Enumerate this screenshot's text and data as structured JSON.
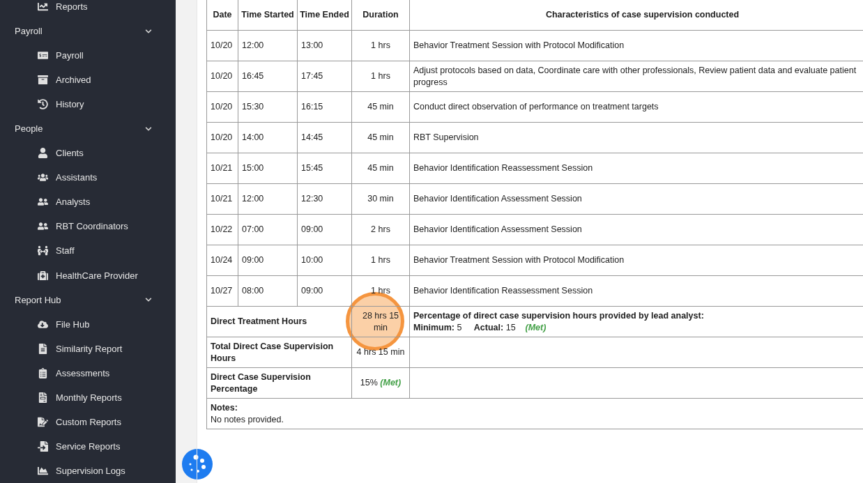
{
  "sidebar": {
    "items": [
      {
        "kind": "link",
        "label": "Reports"
      },
      {
        "kind": "section",
        "label": "Payroll",
        "expanded": true
      },
      {
        "kind": "link",
        "label": "Payroll"
      },
      {
        "kind": "link",
        "label": "Archived"
      },
      {
        "kind": "link",
        "label": "History"
      },
      {
        "kind": "section",
        "label": "People",
        "expanded": true
      },
      {
        "kind": "link",
        "label": "Clients"
      },
      {
        "kind": "link",
        "label": "Assistants"
      },
      {
        "kind": "link",
        "label": "Analysts"
      },
      {
        "kind": "link",
        "label": "RBT Coordinators"
      },
      {
        "kind": "link",
        "label": "Staff"
      },
      {
        "kind": "link",
        "label": "HealthCare Provider"
      },
      {
        "kind": "section",
        "label": "Report Hub",
        "expanded": true
      },
      {
        "kind": "link",
        "label": "File Hub"
      },
      {
        "kind": "link",
        "label": "Similarity Report"
      },
      {
        "kind": "link",
        "label": "Assessments"
      },
      {
        "kind": "link",
        "label": "Monthly Reports"
      },
      {
        "kind": "link",
        "label": "Custom Reports"
      },
      {
        "kind": "link",
        "label": "Service Reports"
      },
      {
        "kind": "link",
        "label": "Supervision Logs"
      }
    ]
  },
  "table": {
    "columns": [
      "Date",
      "Time Started",
      "Time Ended",
      "Duration",
      "Characteristics of case supervision conducted"
    ],
    "rows": [
      {
        "date": "10/20",
        "start": "12:00",
        "end": "13:00",
        "duration": "1 hrs",
        "characteristics": "Behavior Treatment Session with Protocol Modification"
      },
      {
        "date": "10/20",
        "start": "16:45",
        "end": "17:45",
        "duration": "1 hrs",
        "characteristics": "Adjust protocols based on data, Coordinate care with other professionals, Review patient data and evaluate patient progress"
      },
      {
        "date": "10/20",
        "start": "15:30",
        "end": "16:15",
        "duration": "45 min",
        "characteristics": "Conduct direct observation of performance on treatment targets"
      },
      {
        "date": "10/20",
        "start": "14:00",
        "end": "14:45",
        "duration": "45 min",
        "characteristics": "RBT Supervision"
      },
      {
        "date": "10/21",
        "start": "15:00",
        "end": "15:45",
        "duration": "45 min",
        "characteristics": "Behavior Identification Reassessment Session"
      },
      {
        "date": "10/21",
        "start": "12:00",
        "end": "12:30",
        "duration": "30 min",
        "characteristics": "Behavior Identification Assessment Session"
      },
      {
        "date": "10/22",
        "start": "07:00",
        "end": "09:00",
        "duration": "2 hrs",
        "characteristics": "Behavior Identification Assessment Session"
      },
      {
        "date": "10/24",
        "start": "09:00",
        "end": "10:00",
        "duration": "1 hrs",
        "characteristics": "Behavior Treatment Session with Protocol Modification"
      },
      {
        "date": "10/27",
        "start": "08:00",
        "end": "09:00",
        "duration": "1 hrs",
        "characteristics": "Behavior Identification Reassessment Session"
      }
    ],
    "summary": [
      {
        "label": "Direct Treatment Hours",
        "value": "28 hrs 15 min",
        "detail": {
          "title": "Percentage of direct case supervision hours provided by lead analyst:",
          "minimum_label": "Minimum:",
          "minimum": "5",
          "actual_label": "Actual:",
          "actual": "15",
          "status": "(Met)"
        }
      },
      {
        "label": "Total Direct Case Supervision Hours",
        "value": "4 hrs 15 min"
      },
      {
        "label": "Direct Case Supervision Percentage",
        "value": "15%",
        "status": "(Met)"
      }
    ],
    "notes": {
      "label": "Notes:",
      "text": "No notes provided."
    }
  }
}
